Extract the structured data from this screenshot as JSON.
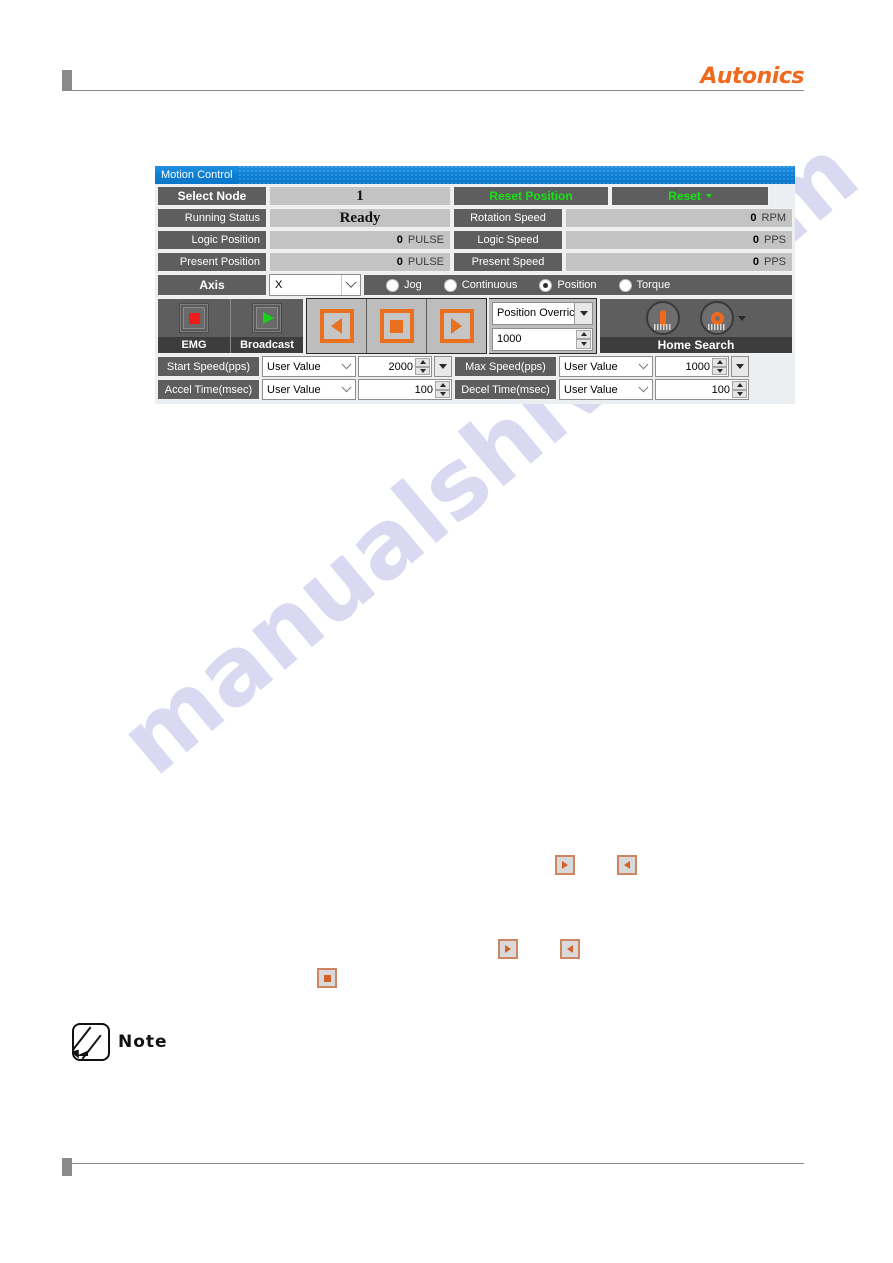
{
  "page": {
    "brand": "Autonics",
    "watermark": "manualshive.com"
  },
  "panel": {
    "title": "Motion Control",
    "rows": {
      "select_node": {
        "label": "Select Node",
        "value": "1"
      },
      "reset_position_button": "Reset Position",
      "reset_button": "Reset",
      "running_status": {
        "label": "Running Status",
        "value": "Ready"
      },
      "rotation_speed": {
        "label": "Rotation Speed",
        "value": "0",
        "unit": "RPM"
      },
      "logic_position": {
        "label": "Logic Position",
        "value": "0",
        "unit": "PULSE"
      },
      "logic_speed": {
        "label": "Logic Speed",
        "value": "0",
        "unit": "PPS"
      },
      "present_position": {
        "label": "Present Position",
        "value": "0",
        "unit": "PULSE"
      },
      "present_speed": {
        "label": "Present Speed",
        "value": "0",
        "unit": "PPS"
      }
    },
    "axis": {
      "label": "Axis",
      "selected": "X"
    },
    "modes": [
      {
        "label": "Jog",
        "selected": false
      },
      {
        "label": "Continuous",
        "selected": false
      },
      {
        "label": "Position",
        "selected": true
      },
      {
        "label": "Torque",
        "selected": false
      }
    ],
    "tools": {
      "emg": "EMG",
      "broadcast": "Broadcast",
      "home_search": "Home Search"
    },
    "override": {
      "mode": "Position Overric",
      "value": "1000"
    },
    "speeds": [
      {
        "label": "Start Speed(pps)",
        "source": "User Value",
        "value": "2000",
        "has_drop": true
      },
      {
        "label": "Max Speed(pps)",
        "source": "User Value",
        "value": "1000",
        "has_drop": true
      },
      {
        "label": "Accel Time(msec)",
        "source": "User Value",
        "value": "100",
        "has_drop": false
      },
      {
        "label": "Decel Time(msec)",
        "source": "User Value",
        "value": "100",
        "has_drop": false
      }
    ]
  },
  "body_icons": {
    "row1_right": "play-right-icon",
    "row1_left": "play-left-icon",
    "row2_right": "play-right-icon",
    "row2_left": "play-left-icon",
    "row3_stop": "stop-icon"
  },
  "note": {
    "label": "Note"
  },
  "colors": {
    "brand_orange": "#ef6a1f",
    "title_blue": "#0c7fd4",
    "label_gray": "#5e5e5e",
    "value_gray": "#c3c3c3",
    "accent_orange": "#e8701e",
    "green_text": "#13e413",
    "watermark": "#d9daf2"
  }
}
